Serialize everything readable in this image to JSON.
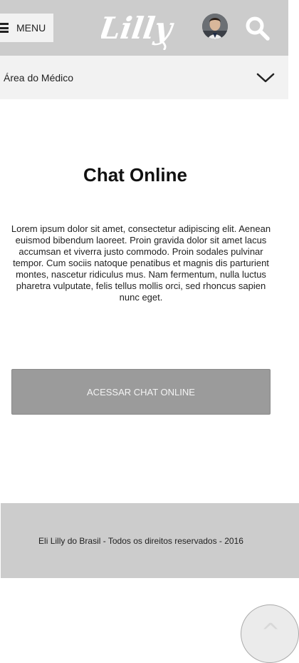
{
  "header": {
    "menu_label": "MENU",
    "logo_text": "Lilly"
  },
  "area_selector": {
    "label": "Área do Médico"
  },
  "main": {
    "title": "Chat Online",
    "body": "Lorem ipsum dolor sit amet, consectetur adipiscing elit. Aenean euismod bibendum laoreet. Proin gravida dolor sit amet lacus accumsan et viverra justo commodo. Proin sodales pulvinar tempor. Cum sociis natoque penatibus et magnis dis parturient montes, nascetur ridiculus mus. Nam fermentum, nulla luctus pharetra vulputate, felis tellus mollis orci, sed rhoncus sapien nunc eget.",
    "cta_label": "ACESSAR CHAT ONLINE"
  },
  "footer": {
    "text": "Eli Lilly do Brasil - Todos os direitos reservados - 2016"
  },
  "back_to_top": {
    "symbol": "^"
  },
  "icons": {
    "menu": "hamburger-icon",
    "search": "search-icon",
    "dropdown": "chevron-down-icon",
    "avatar": "user-avatar"
  },
  "colors": {
    "header_bg": "#cccccc",
    "area_bg": "#f2f2f2",
    "cta_bg": "#9b9b9b",
    "footer_bg": "#cccccc",
    "logo": "#ffffff"
  }
}
